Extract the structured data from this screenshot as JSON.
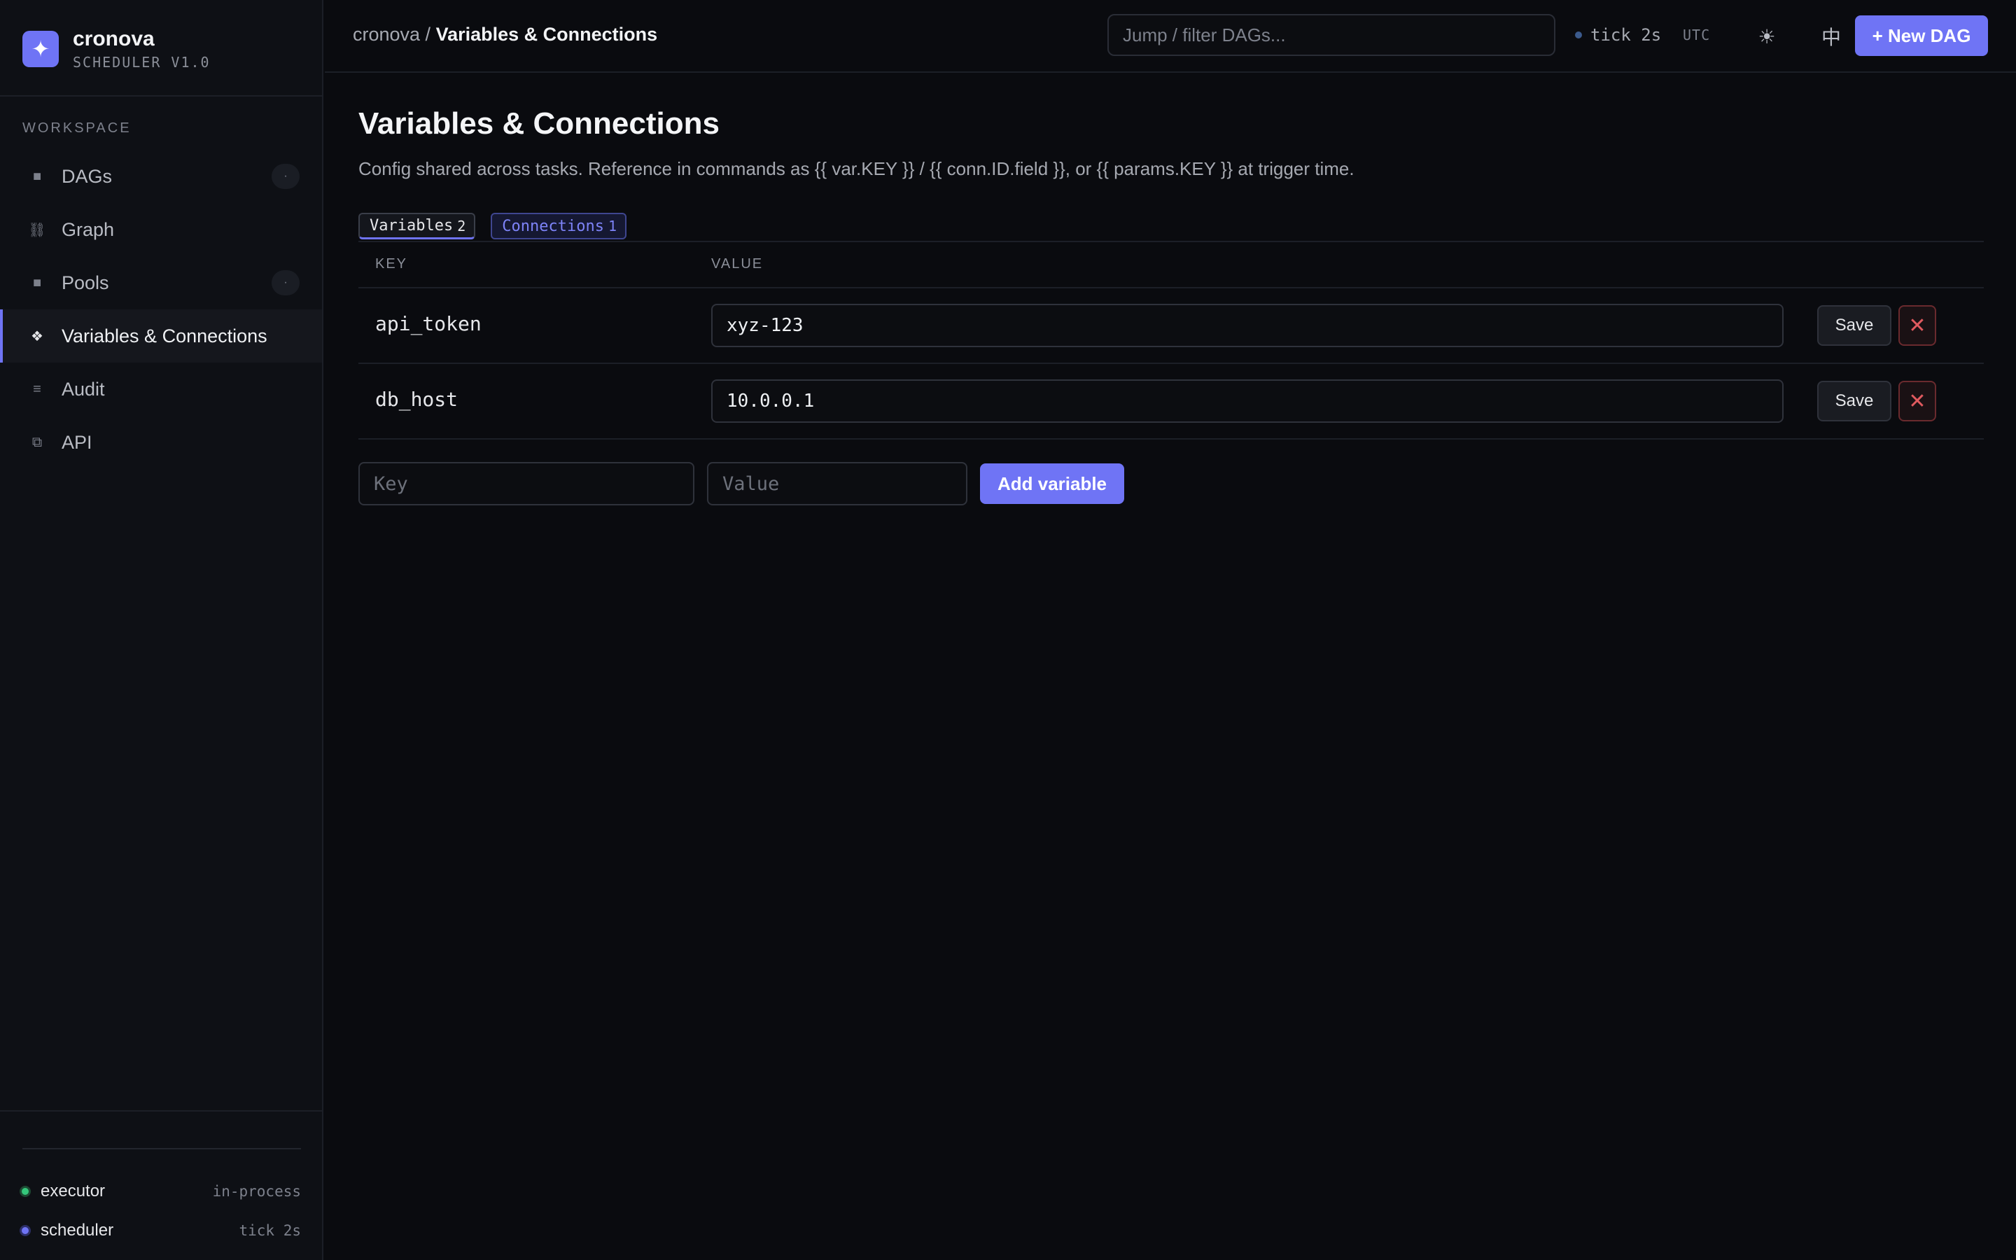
{
  "brand": {
    "name": "cronova",
    "subtitle": "SCHEDULER V1.0",
    "logo_icon": "sparkle-icon",
    "accent": "#6f74f5"
  },
  "sidebar": {
    "section_label": "WORKSPACE",
    "items": [
      {
        "label": "DAGs",
        "icon": "square-icon",
        "glyph": "■",
        "badge": "·"
      },
      {
        "label": "Graph",
        "icon": "graph-icon",
        "glyph": "⛓",
        "badge": ""
      },
      {
        "label": "Pools",
        "icon": "square-icon",
        "glyph": "■",
        "badge": "·"
      },
      {
        "label": "Variables & Connections",
        "icon": "diamond-icon",
        "glyph": "❖",
        "badge": "",
        "active": true
      },
      {
        "label": "Audit",
        "icon": "list-icon",
        "glyph": "≡",
        "badge": ""
      },
      {
        "label": "API",
        "icon": "api-icon",
        "glyph": "⧉",
        "badge": ""
      }
    ],
    "status": [
      {
        "name": "executor",
        "value": "in-process",
        "color": "#34c77b"
      },
      {
        "name": "scheduler",
        "value": "tick 2s",
        "color": "#6f74f5"
      }
    ]
  },
  "header": {
    "breadcrumb_root": "cronova / ",
    "breadcrumb_current": "Variables & Connections",
    "search_placeholder": "Jump / filter DAGs...",
    "tick": "tick 2s",
    "timezone": "UTC",
    "theme_icon": "sun-icon",
    "theme_glyph": "☀",
    "lang_label": "中",
    "new_dag_label": "+ New DAG"
  },
  "main": {
    "title": "Variables & Connections",
    "description": "Config shared across tasks. Reference in commands as {{ var.KEY }} / {{ conn.ID.field }}, or {{ params.KEY }} at trigger time.",
    "tabs": [
      {
        "label": "Variables",
        "count": "2",
        "active": true
      },
      {
        "label": "Connections",
        "count": "1",
        "active": false
      }
    ],
    "columns": {
      "key": "KEY",
      "value": "VALUE"
    },
    "rows": [
      {
        "key": "api_token",
        "value": "xyz-123",
        "save_label": "Save",
        "delete_glyph": "✕"
      },
      {
        "key": "db_host",
        "value": "10.0.0.1",
        "save_label": "Save",
        "delete_glyph": "✕"
      }
    ],
    "new_key_placeholder": "Key",
    "new_value_placeholder": "Value",
    "add_label": "Add variable"
  }
}
